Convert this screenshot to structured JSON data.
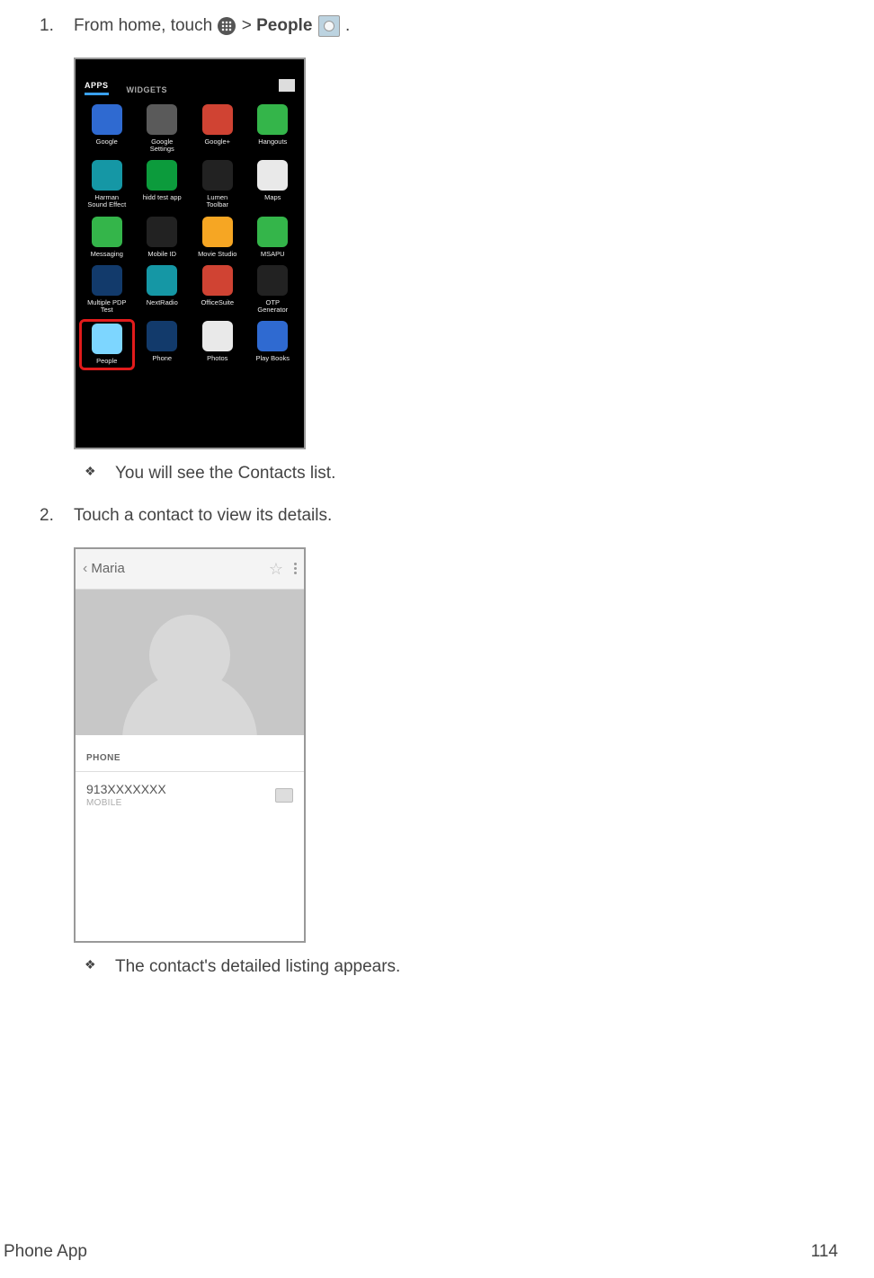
{
  "footer": {
    "left": "Phone App",
    "right": "114"
  },
  "step1": {
    "num": "1.",
    "text_before": "From home, touch ",
    "text_mid": " > ",
    "people": "People",
    "text_after": " .",
    "sub": "You will see the Contacts list."
  },
  "step2": {
    "num": "2.",
    "text": "Touch a contact to view its details.",
    "sub": "The contact's detailed listing appears."
  },
  "shot1": {
    "tab_apps": "APPS",
    "tab_widgets": "WIDGETS",
    "apps": [
      {
        "label": "Google",
        "cls": "blue"
      },
      {
        "label": "Google\nSettings",
        "cls": "grey"
      },
      {
        "label": "Google+",
        "cls": "red"
      },
      {
        "label": "Hangouts",
        "cls": "green"
      },
      {
        "label": "Harman\nSound Effect",
        "cls": "teal"
      },
      {
        "label": "hidd test app",
        "cls": "greenN"
      },
      {
        "label": "Lumen\nToolbar",
        "cls": "dark"
      },
      {
        "label": "Maps",
        "cls": "white"
      },
      {
        "label": "Messaging",
        "cls": "green"
      },
      {
        "label": "Mobile ID",
        "cls": "dark"
      },
      {
        "label": "Movie Studio",
        "cls": "yellow"
      },
      {
        "label": "MSAPU",
        "cls": "green"
      },
      {
        "label": "Multiple PDP\nTest",
        "cls": "navy"
      },
      {
        "label": "NextRadio",
        "cls": "teal"
      },
      {
        "label": "OfficeSuite",
        "cls": "red"
      },
      {
        "label": "OTP\nGenerator",
        "cls": "dark"
      },
      {
        "label": "People",
        "cls": "sky",
        "hl": true
      },
      {
        "label": "Phone",
        "cls": "navy"
      },
      {
        "label": "Photos",
        "cls": "white"
      },
      {
        "label": "Play Books",
        "cls": "blue"
      }
    ]
  },
  "shot2": {
    "name": "Maria",
    "section_phone": "PHONE",
    "number": "913XXXXXXX",
    "type": "MOBILE"
  }
}
